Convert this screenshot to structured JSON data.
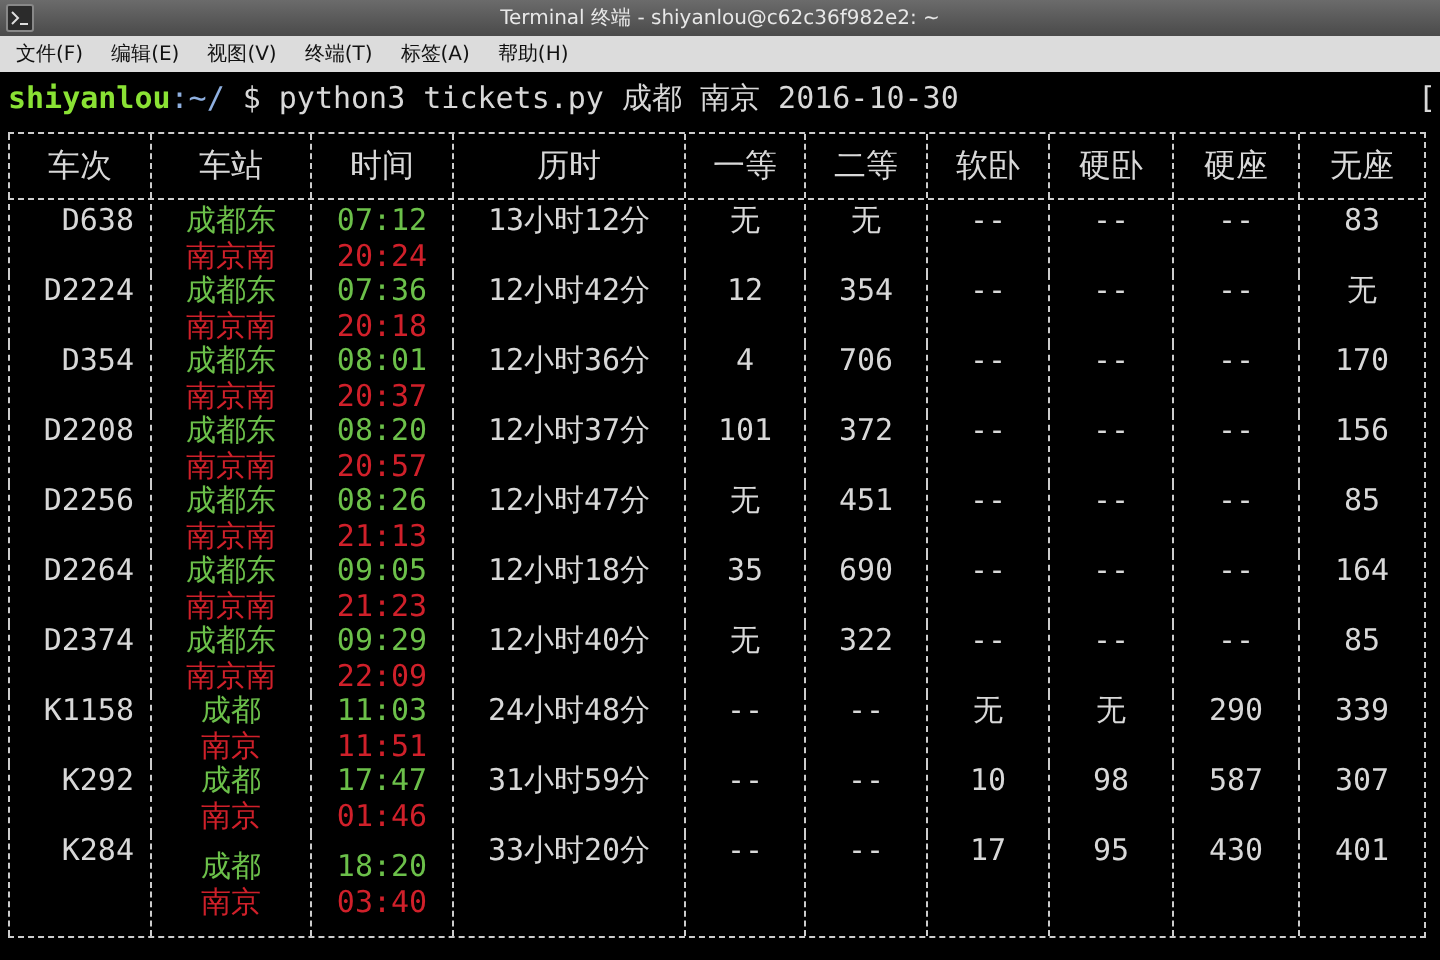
{
  "window": {
    "title": "Terminal 终端 - shiyanlou@c62c36f982e2: ~"
  },
  "menu": [
    "文件(F)",
    "编辑(E)",
    "视图(V)",
    "终端(T)",
    "标签(A)",
    "帮助(H)"
  ],
  "prompt": {
    "user": "shiyanlou",
    "path": ":~/",
    "symbol": "$",
    "command": "python3 tickets.py 成都 南京 2016-10-30",
    "edge": "["
  },
  "table": {
    "columns": [
      "车次",
      "车站",
      "时间",
      "历时",
      "一等",
      "二等",
      "软卧",
      "硬卧",
      "硬座",
      "无座"
    ],
    "rows": [
      {
        "train": "D638",
        "depart": {
          "station": "成都东",
          "time": "07:12"
        },
        "arrive": {
          "station": "南京南",
          "time": "20:24"
        },
        "duration": "13小时12分",
        "seats": [
          "无",
          "无",
          "--",
          "--",
          "--",
          "83"
        ]
      },
      {
        "train": "D2224",
        "depart": {
          "station": "成都东",
          "time": "07:36"
        },
        "arrive": {
          "station": "南京南",
          "time": "20:18"
        },
        "duration": "12小时42分",
        "seats": [
          "12",
          "354",
          "--",
          "--",
          "--",
          "无"
        ]
      },
      {
        "train": "D354",
        "depart": {
          "station": "成都东",
          "time": "08:01"
        },
        "arrive": {
          "station": "南京南",
          "time": "20:37"
        },
        "duration": "12小时36分",
        "seats": [
          "4",
          "706",
          "--",
          "--",
          "--",
          "170"
        ]
      },
      {
        "train": "D2208",
        "depart": {
          "station": "成都东",
          "time": "08:20"
        },
        "arrive": {
          "station": "南京南",
          "time": "20:57"
        },
        "duration": "12小时37分",
        "seats": [
          "101",
          "372",
          "--",
          "--",
          "--",
          "156"
        ]
      },
      {
        "train": "D2256",
        "depart": {
          "station": "成都东",
          "time": "08:26"
        },
        "arrive": {
          "station": "南京南",
          "time": "21:13"
        },
        "duration": "12小时47分",
        "seats": [
          "无",
          "451",
          "--",
          "--",
          "--",
          "85"
        ]
      },
      {
        "train": "D2264",
        "depart": {
          "station": "成都东",
          "time": "09:05"
        },
        "arrive": {
          "station": "南京南",
          "time": "21:23"
        },
        "duration": "12小时18分",
        "seats": [
          "35",
          "690",
          "--",
          "--",
          "--",
          "164"
        ]
      },
      {
        "train": "D2374",
        "depart": {
          "station": "成都东",
          "time": "09:29"
        },
        "arrive": {
          "station": "南京南",
          "time": "22:09"
        },
        "duration": "12小时40分",
        "seats": [
          "无",
          "322",
          "--",
          "--",
          "--",
          "85"
        ]
      },
      {
        "train": "K1158",
        "depart": {
          "station": "成都",
          "time": "11:03"
        },
        "arrive": {
          "station": "南京",
          "time": "11:51"
        },
        "duration": "24小时48分",
        "seats": [
          "--",
          "--",
          "无",
          "无",
          "290",
          "339"
        ]
      },
      {
        "train": "K292",
        "depart": {
          "station": "成都",
          "time": "17:47"
        },
        "arrive": {
          "station": "南京",
          "time": "01:46"
        },
        "duration": "31小时59分",
        "seats": [
          "--",
          "--",
          "10",
          "98",
          "587",
          "307"
        ]
      },
      {
        "train": "K284",
        "depart": {
          "station": "成都",
          "time": "18:20"
        },
        "arrive": {
          "station": "南京",
          "time": "03:40"
        },
        "duration": "33小时20分",
        "seats": [
          "--",
          "--",
          "17",
          "95",
          "430",
          "401"
        ]
      }
    ]
  }
}
